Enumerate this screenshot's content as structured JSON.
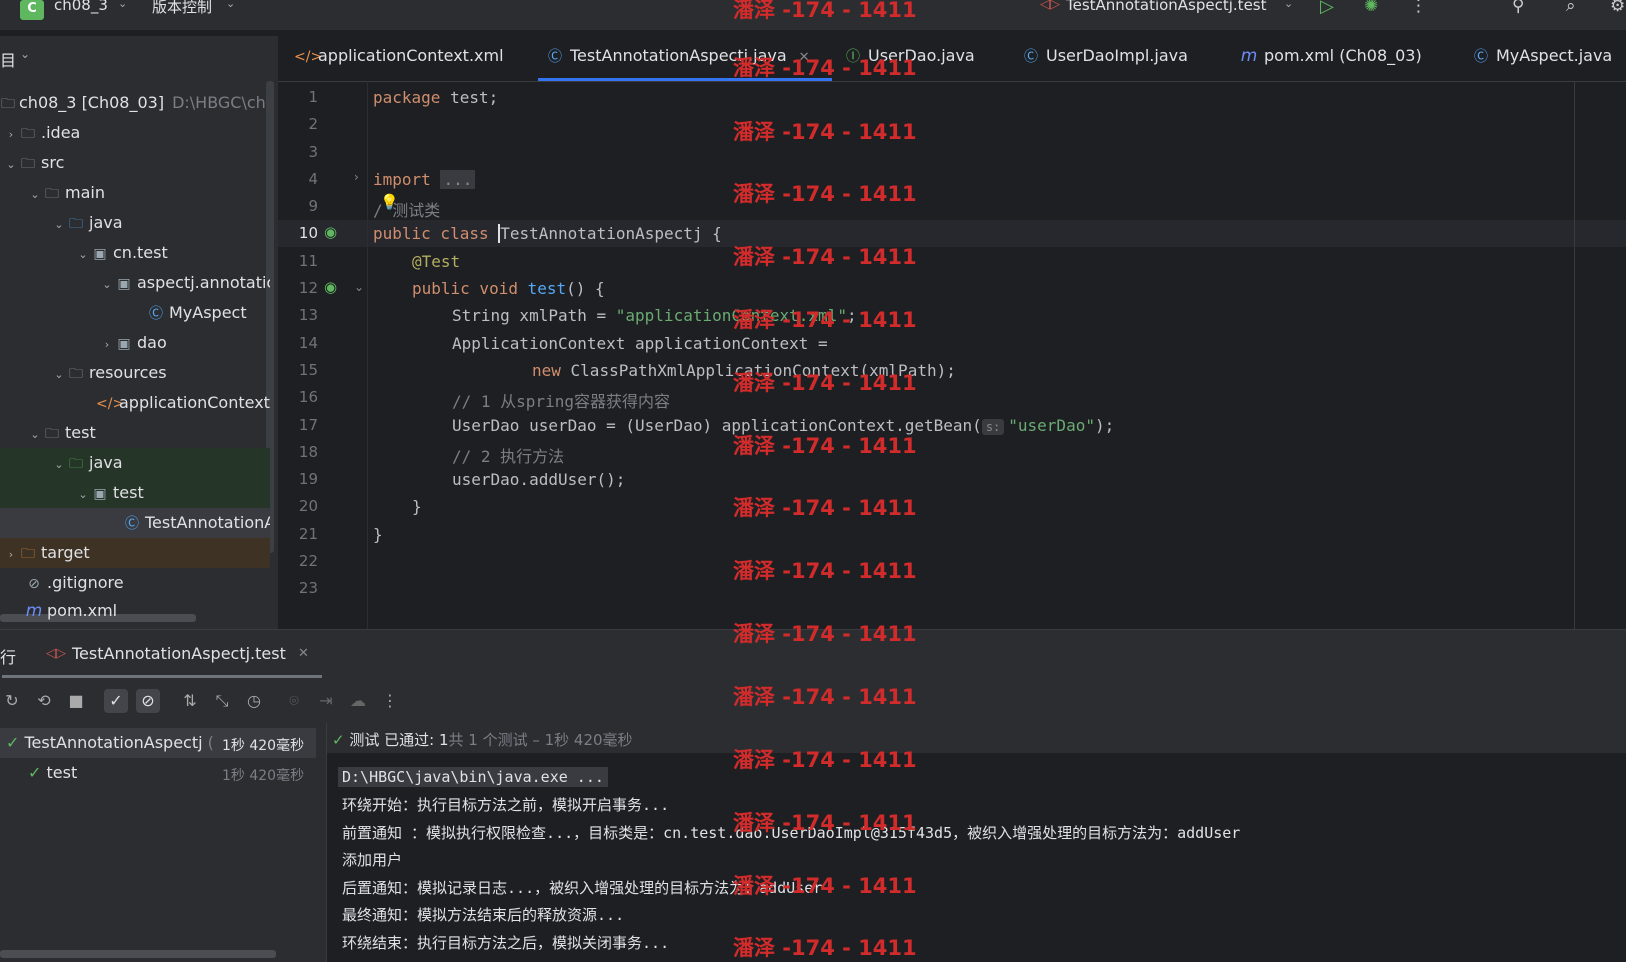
{
  "titlebar": {
    "project_badge": "C",
    "project_name": "ch08_3",
    "vcs_label": "版本控制",
    "run_config": "TestAnnotationAspectj.test"
  },
  "tabs": [
    {
      "label": "applicationContext.xml",
      "icon": "xml-icon",
      "active": false
    },
    {
      "label": "TestAnnotationAspectj.java",
      "icon": "class-icon",
      "active": true
    },
    {
      "label": "UserDao.java",
      "icon": "interface-icon",
      "active": false
    },
    {
      "label": "UserDaoImpl.java",
      "icon": "class-icon",
      "active": false
    },
    {
      "label": "pom.xml (Ch08_03)",
      "icon": "maven-icon",
      "active": false
    },
    {
      "label": "MyAspect.java",
      "icon": "class-icon",
      "active": false
    }
  ],
  "project_panel": {
    "header": "目",
    "tree": [
      {
        "label": "ch08_3 [Ch08_03]",
        "extra": "D:\\HBGC\\ch"
      },
      {
        "label": ".idea"
      },
      {
        "label": "src"
      },
      {
        "label": "main"
      },
      {
        "label": "java"
      },
      {
        "label": "cn.test"
      },
      {
        "label": "aspectj.annotatic"
      },
      {
        "label": "MyAspect"
      },
      {
        "label": "dao"
      },
      {
        "label": "resources"
      },
      {
        "label": "applicationContext.x"
      },
      {
        "label": "test"
      },
      {
        "label": "java"
      },
      {
        "label": "test"
      },
      {
        "label": "TestAnnotationA"
      },
      {
        "label": "target"
      },
      {
        "label": ".gitignore"
      },
      {
        "label": "pom.xml"
      }
    ]
  },
  "editor": {
    "line_numbers": [
      "1",
      "2",
      "3",
      "4",
      "9",
      "10",
      "11",
      "12",
      "13",
      "14",
      "15",
      "16",
      "17",
      "18",
      "19",
      "20",
      "21",
      "22",
      "23"
    ],
    "lines": {
      "l1_kw": "package",
      "l1_rest": " test;",
      "l4_kw": "import",
      "l4_fold": "...",
      "l9": "/ 测试类",
      "l10_kw": "public class",
      "l10_name": "TestAnnotationAspectj",
      "l10_rest": " {",
      "l11": "@Test",
      "l12_kw": "public void",
      "l12_fn": "test",
      "l12_rest": "() {",
      "l13_a": "String xmlPath = ",
      "l13_str": "\"applicationContext.xml\"",
      "l13_b": ";",
      "l14": "ApplicationContext applicationContext =",
      "l15_kw": "new",
      "l15_rest": " ClassPathXmlApplicationContext(xmlPath);",
      "l16": "// 1 从spring容器获得内容",
      "l17_a": "UserDao userDao = (UserDao) applicationContext.getBean(",
      "l17_hint": "s:",
      "l17_str": "\"userDao\"",
      "l17_b": ");",
      "l18": "// 2 执行方法",
      "l19": "userDao.addUser();",
      "l20": "}",
      "l21": "}"
    }
  },
  "run_window": {
    "title_prefix": "行",
    "tab_label": "TestAnnotationAspectj.test",
    "tree": [
      {
        "label": "TestAnnotationAspectj",
        "suffix": "(",
        "time": "1秒 420毫秒"
      },
      {
        "label": "test",
        "time": "1秒 420毫秒"
      }
    ],
    "status_passed": "测试 已通过: ",
    "status_count": "1",
    "status_rest": "共 1 个测试 – 1秒 420毫秒",
    "console": [
      "D:\\HBGC\\java\\bin\\java.exe ...",
      "环绕开始：执行目标方法之前，模拟开启事务...",
      "前置通知 ：模拟执行权限检查...，目标类是：cn.test.dao.UserDaoImpl@315f43d5，被织入增强处理的目标方法为：addUser",
      "添加用户",
      "后置通知：模拟记录日志...，被织入增强处理的目标方法为：addUser",
      "最终通知：模拟方法结束后的释放资源...",
      "环绕结束：执行目标方法之后，模拟关闭事务..."
    ]
  },
  "watermark": "潘泽 -174 - 1411",
  "colors": {
    "accent": "#3574f0",
    "keyword": "#cf8e6d",
    "string": "#6aab73",
    "watermark": "#d22b2b",
    "pass": "#5fb85f"
  }
}
